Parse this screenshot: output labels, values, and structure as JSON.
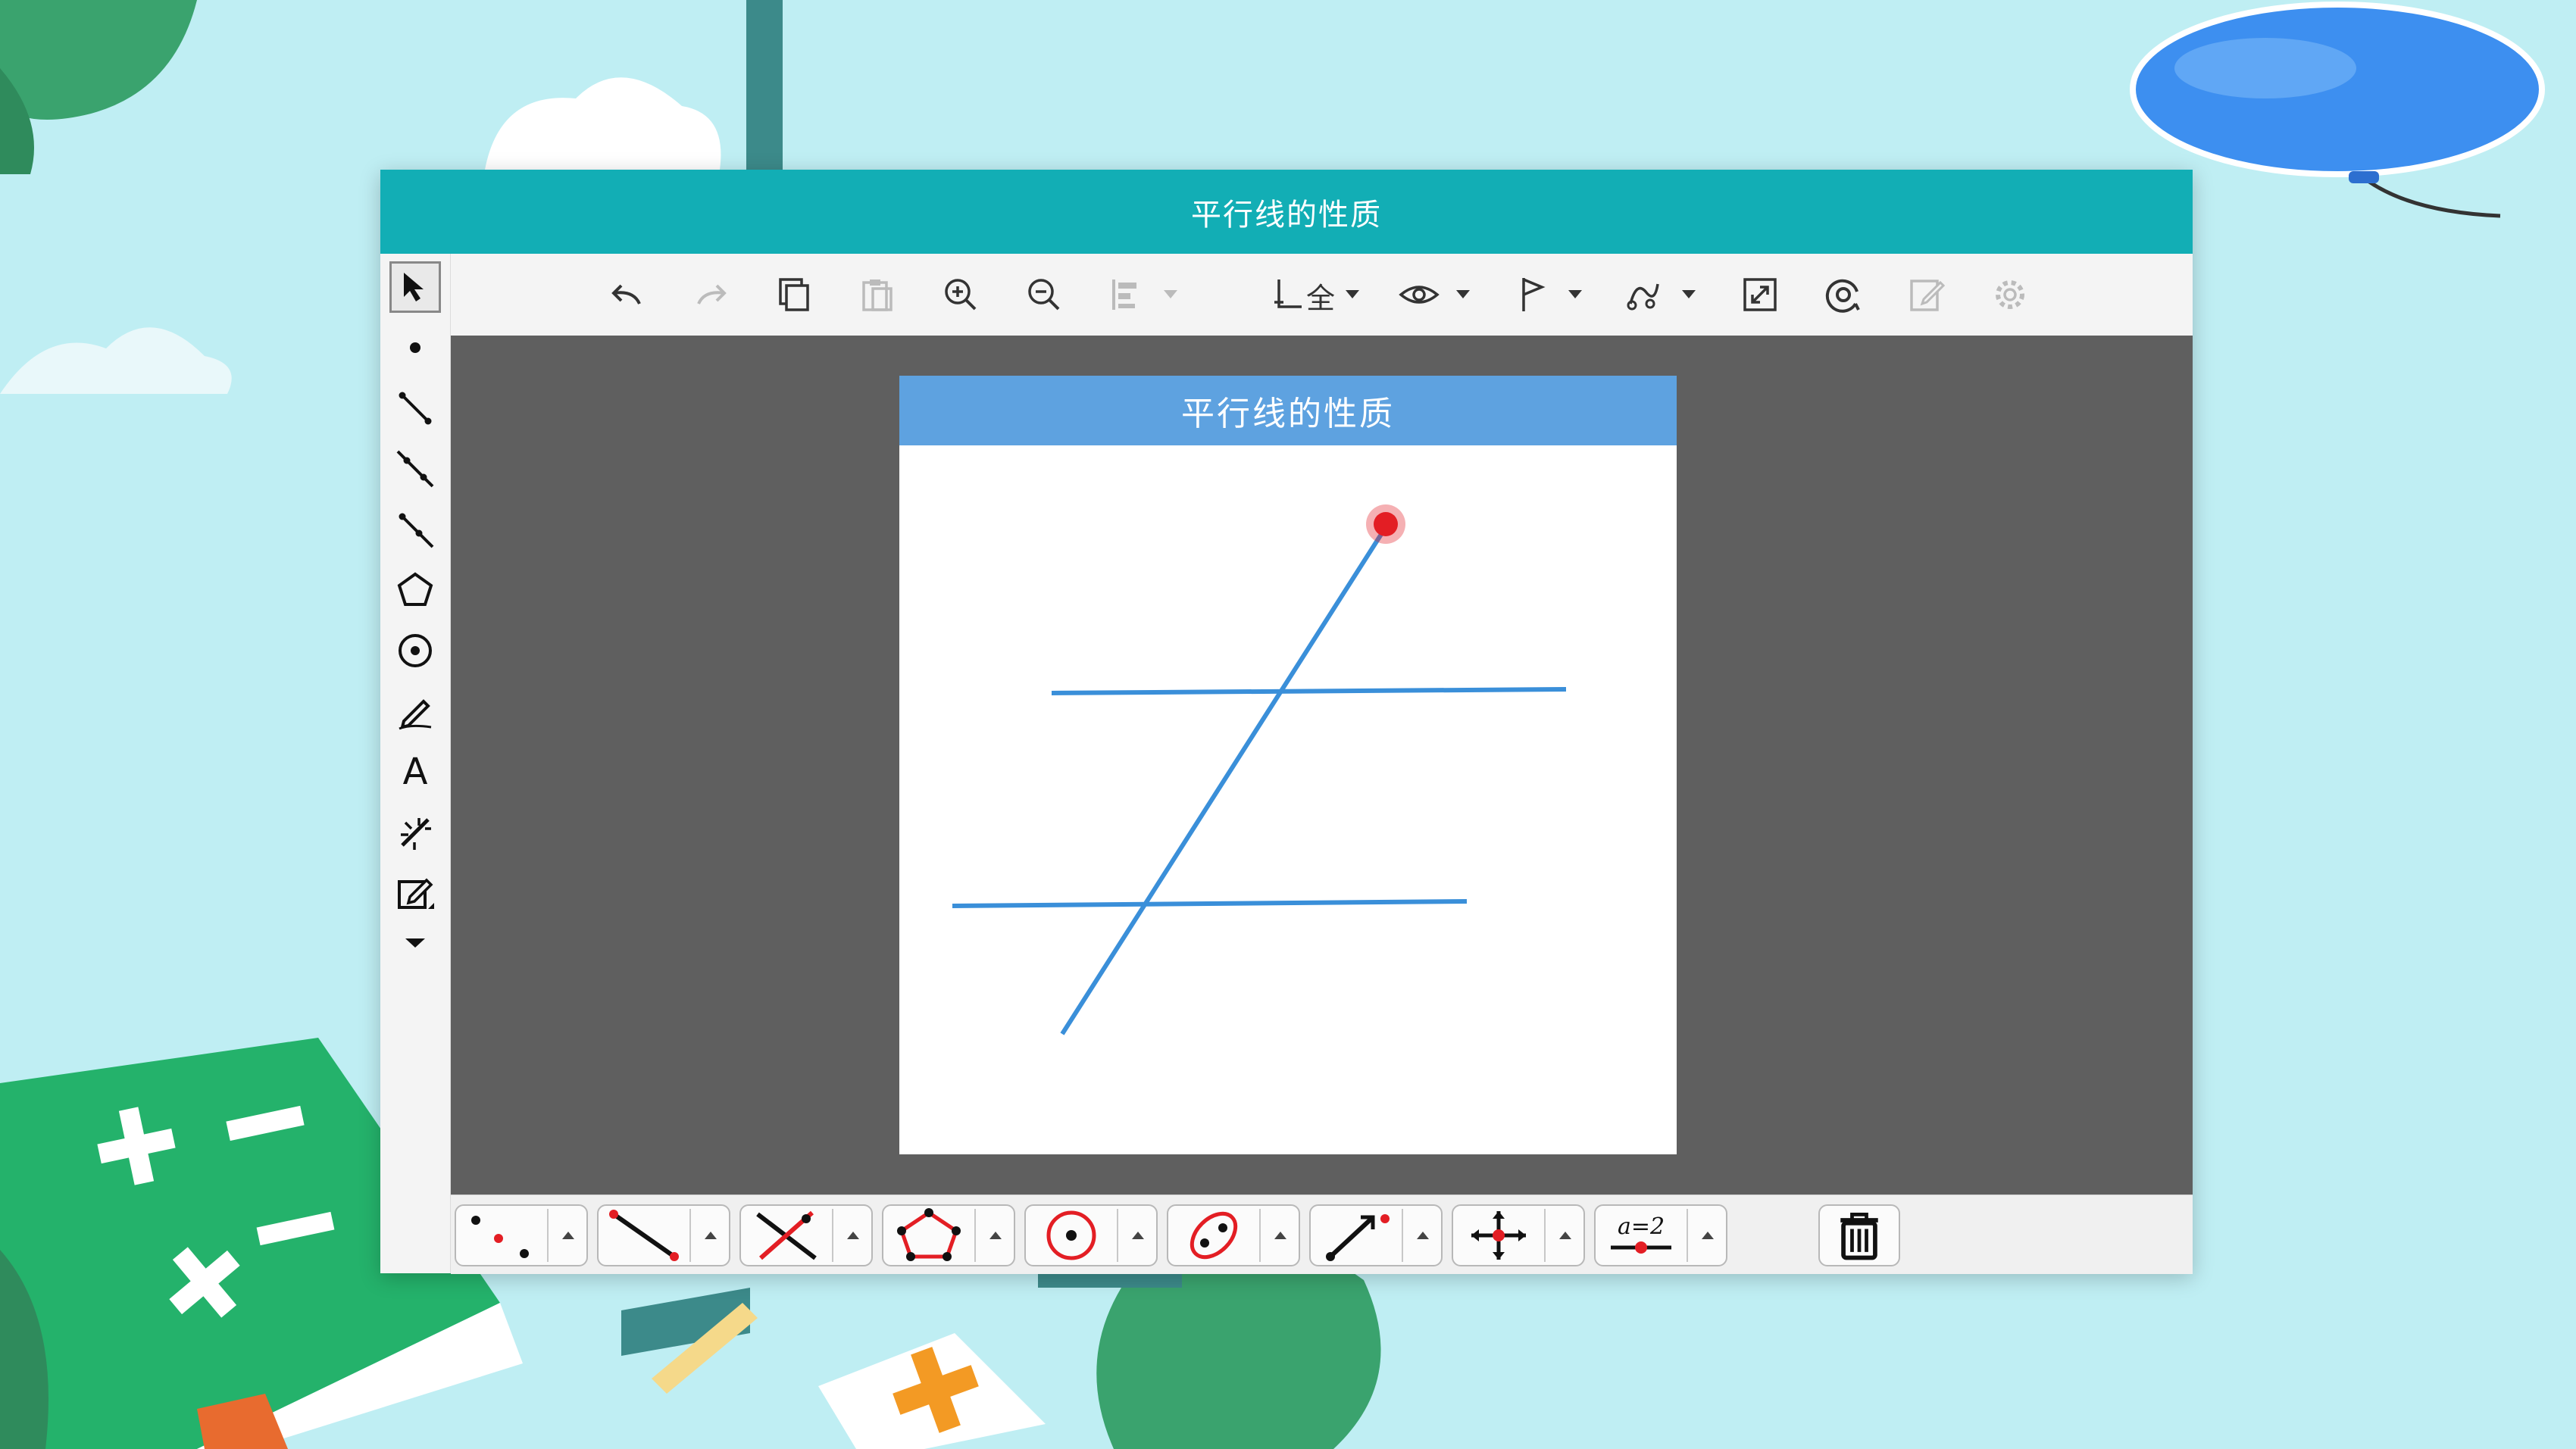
{
  "window": {
    "title": "平行线的性质"
  },
  "board": {
    "title": "平行线的性质",
    "line_color": "#3a8fd9",
    "point_color": "#e31e24"
  },
  "toolbar": {
    "icons": [
      "undo-icon",
      "redo-icon",
      "copy-icon",
      "paste-icon",
      "zoom-in-icon",
      "zoom-out-icon",
      "align-icon",
      "axes-icon",
      "visibility-icon",
      "flag-icon",
      "trace-icon",
      "fullscreen-icon",
      "snapshot-icon",
      "edit-icon",
      "settings-icon"
    ],
    "axes_label": "全"
  },
  "left_tools": {
    "icons": [
      "select-arrow-icon",
      "point-icon",
      "segment-icon",
      "line-icon",
      "ray-icon",
      "polygon-icon",
      "circle-icon",
      "pen-icon",
      "text-icon",
      "transform-icon",
      "edit-note-icon",
      "more-down-icon"
    ],
    "text_tool_label": "A"
  },
  "bottom_toolbar": {
    "groups": [
      "points-tool-group",
      "line-tool-group",
      "intersect-tool-group",
      "polygon-tool-group",
      "circle-tool-group",
      "conic-tool-group",
      "vector-tool-group",
      "move-tool-group",
      "slider-tool-group"
    ],
    "slider_label": "a=2",
    "trash": "trash-icon"
  }
}
